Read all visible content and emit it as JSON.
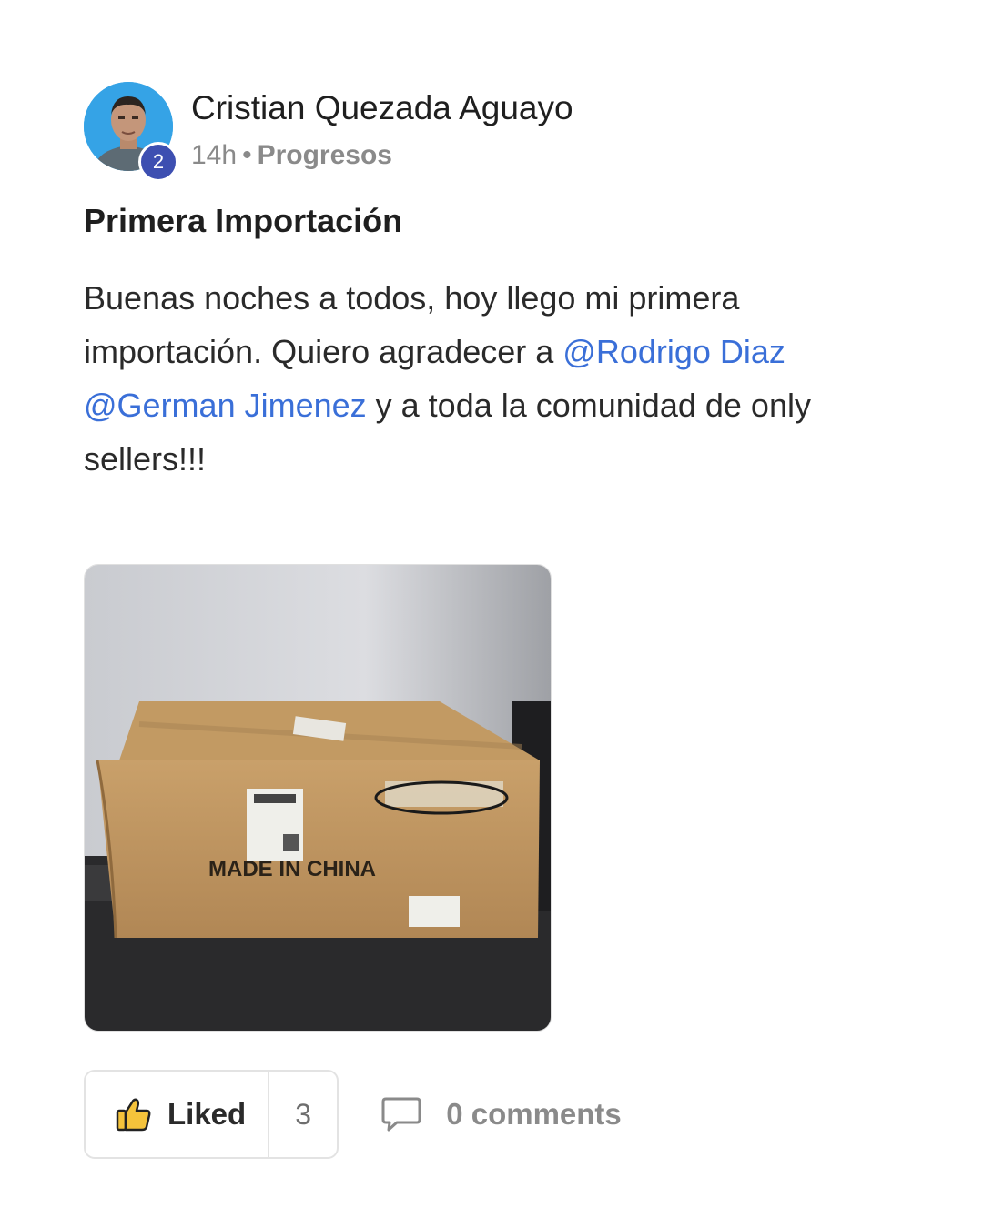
{
  "post": {
    "author": {
      "name": "Cristian Quezada Aguayo",
      "level": "2",
      "avatar_icon": "user-avatar"
    },
    "time": "14h",
    "separator": "•",
    "category": "Progresos",
    "title": "Primera Importación",
    "body": {
      "text1": "Buenas noches a todos, hoy llego mi primera importación. Quiero agradecer a ",
      "mention1": "@Rodrigo Diaz",
      "text2": " ",
      "mention2": "@German Jimenez",
      "text3": " y a toda la comunidad de only sellers!!!"
    },
    "image": {
      "box_text": "MADE IN CHINA"
    },
    "actions": {
      "like_label": "Liked",
      "like_icon": "thumbs-up-icon",
      "like_count": "3",
      "comments_label": "0 comments",
      "comments_icon": "comment-icon"
    }
  },
  "colors": {
    "mention": "#3a6fd8",
    "badge": "#3d4fb1",
    "avatar_bg": "#35a3e6",
    "thumb_fill": "#f5c33b"
  }
}
